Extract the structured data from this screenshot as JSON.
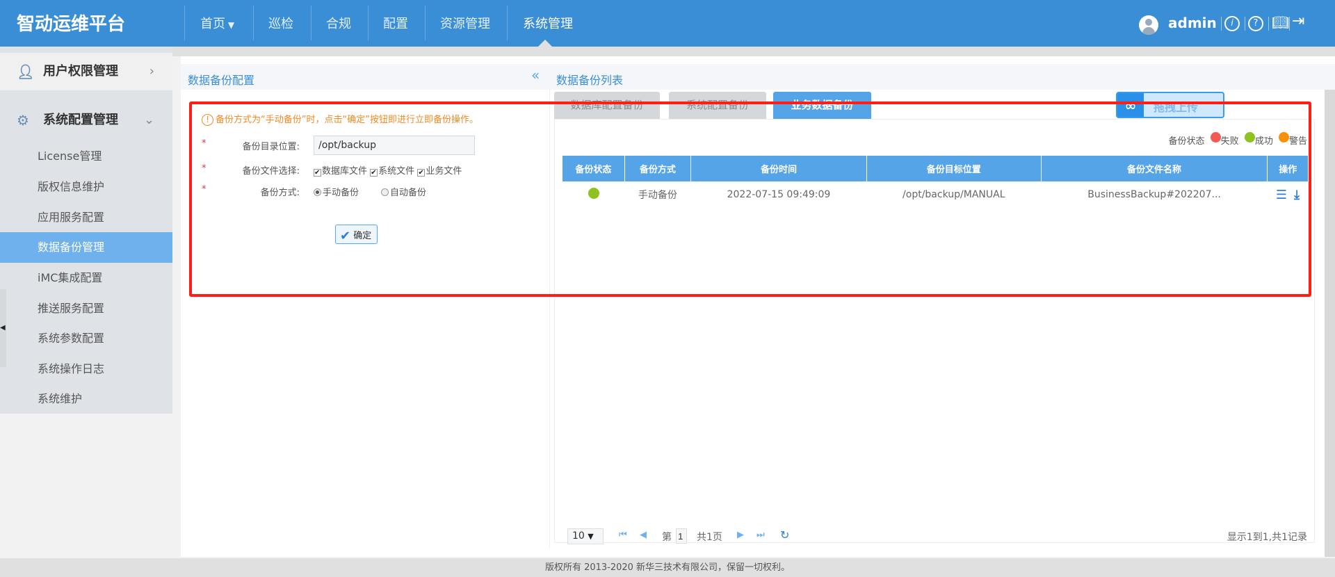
{
  "header": {
    "logo": "智动运维平台",
    "nav": [
      "首页",
      "巡检",
      "合规",
      "配置",
      "资源管理",
      "系统管理"
    ],
    "active_nav": "系统管理",
    "user": "admin"
  },
  "sidebar": {
    "groups": [
      "用户权限管理",
      "系统配置管理"
    ],
    "items": [
      "License管理",
      "版权信息维护",
      "应用服务配置",
      "数据备份管理",
      "iMC集成配置",
      "推送服务配置",
      "系统参数配置",
      "系统操作日志",
      "系统维护"
    ],
    "active": "数据备份管理"
  },
  "left_panel": {
    "title": "数据备份配置",
    "warning": "备份方式为“手动备份”时，点击“确定”按钮即进行立即备份操作。",
    "star": "*",
    "dir_label": "备份目录位置:",
    "dir_value": "/opt/backup",
    "files_label": "备份文件选择:",
    "files": [
      "数据库文件",
      "系统文件",
      "业务文件"
    ],
    "mode_label": "备份方式:",
    "modes": [
      "手动备份",
      "自动备份"
    ],
    "selected_mode": "手动备份",
    "confirm": "确定"
  },
  "right_panel": {
    "title": "数据备份列表",
    "tabs": [
      "数据库配置备份",
      "系统配置备份",
      "业务数据备份"
    ],
    "active_tab": "业务数据备份",
    "upload": "拖拽上传",
    "legend": {
      "label": "备份状态",
      "items": [
        {
          "label": "失败",
          "color": "#f25a52"
        },
        {
          "label": "成功",
          "color": "#8dc21f"
        },
        {
          "label": "警告",
          "color": "#f7900a"
        }
      ]
    },
    "columns": [
      "备份状态",
      "备份方式",
      "备份时间",
      "备份目标位置",
      "备份文件名称",
      "操作"
    ],
    "rows": [
      {
        "status": "成功",
        "mode": "手动备份",
        "time": "2022-07-15 09:49:09",
        "target": "/opt/backup/MANUAL",
        "file": "BusinessBackup#202207..."
      }
    ],
    "pager": {
      "page_size": "10",
      "page_prefix": "第",
      "page": "1",
      "total_pages": "共1页",
      "summary": "显示1到1,共1记录"
    }
  },
  "footer": "版权所有 2013-2020 新华三技术有限公司，保留一切权利。"
}
